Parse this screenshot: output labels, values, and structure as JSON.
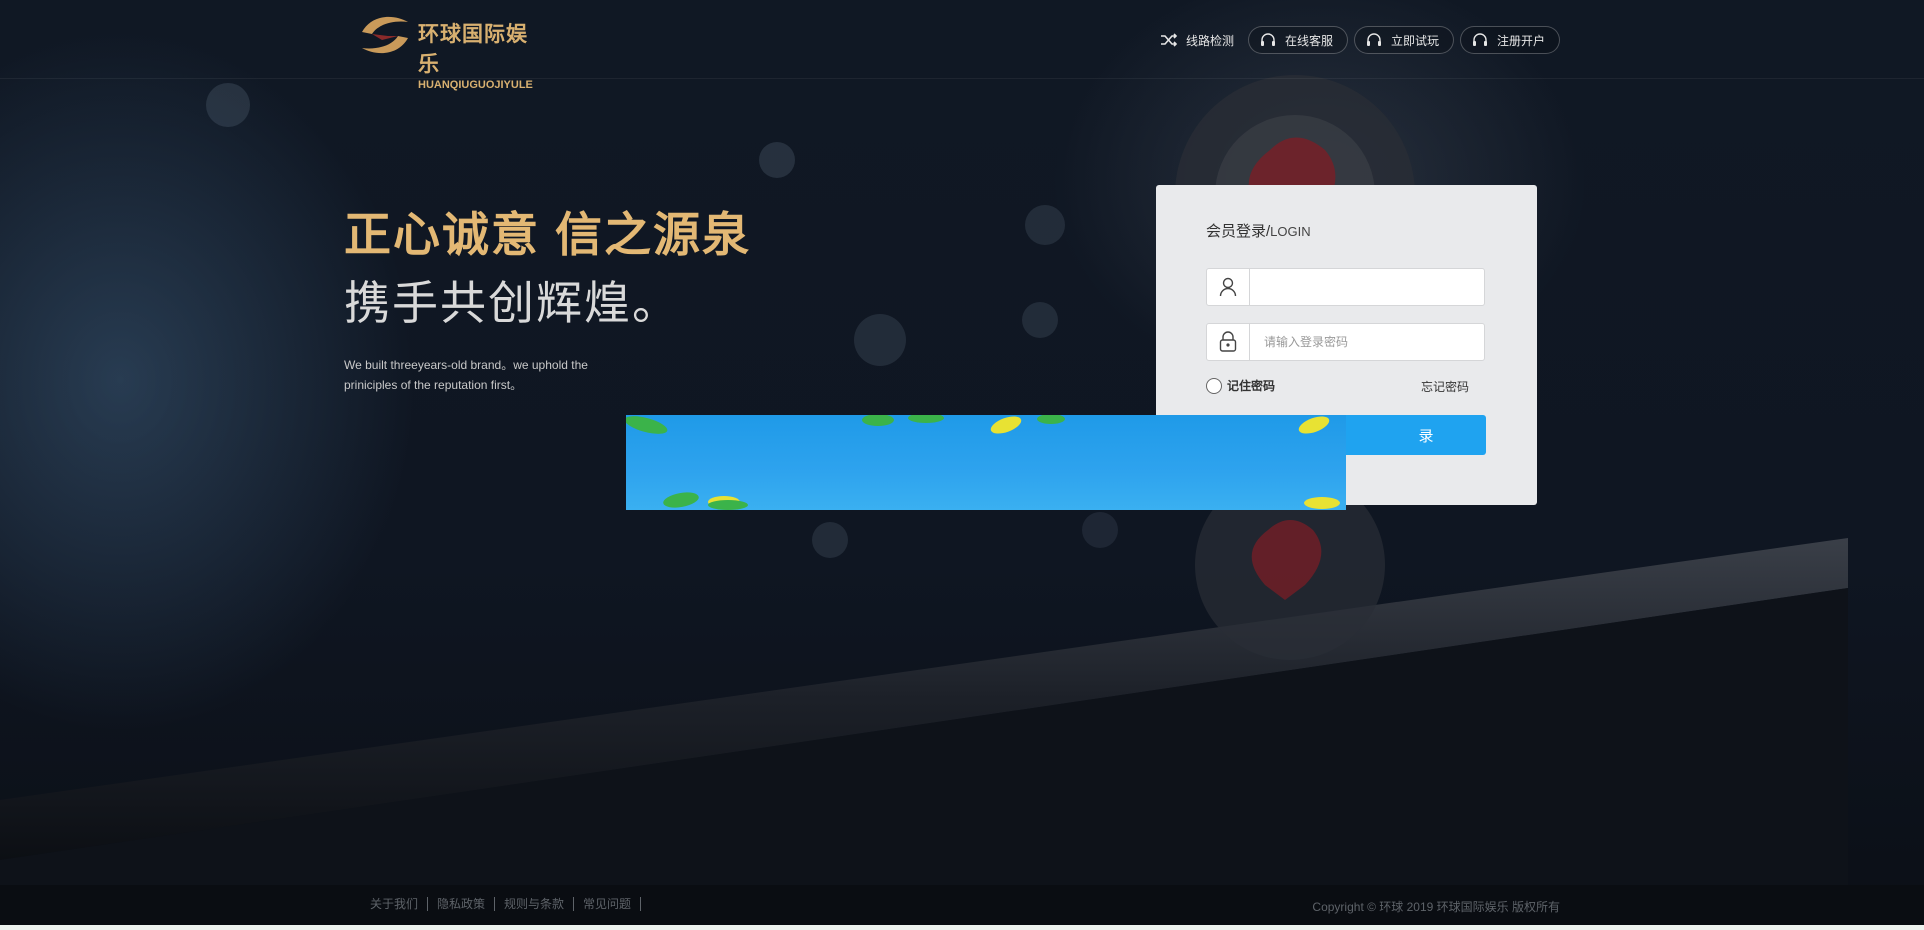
{
  "colors": {
    "accent_gold": "#e3b874",
    "login_button": "#1fa3f0",
    "panel_bg": "#e9eaec",
    "page_bg": "#0d1118"
  },
  "header": {
    "logo": {
      "cn": "环球国际娱乐",
      "en": "HUANQIUGUOJIYULE"
    },
    "nav": [
      {
        "label": "线路检测",
        "icon": "shuffle-icon"
      },
      {
        "label": "在线客服",
        "icon": "headset-icon"
      },
      {
        "label": "立即试玩",
        "icon": "headset-icon"
      },
      {
        "label": "注册开户",
        "icon": "headset-icon"
      }
    ]
  },
  "slogan": {
    "line1": "正心诚意 信之源泉",
    "line2": "携手共创辉煌。",
    "en_line1": "We built threeyears-old brand。we uphold the",
    "en_line2": "priniciples of the reputation first。"
  },
  "login": {
    "title": "会员登录/",
    "title_en": "LOGIN",
    "username": {
      "value": "",
      "placeholder": "",
      "icon": "user-icon"
    },
    "password": {
      "value": "",
      "placeholder": "请输入登录密码",
      "icon": "lock-icon"
    },
    "remember_label": "记住密码",
    "forgot_label": "忘记密码",
    "submit_label": "录"
  },
  "footer": {
    "links": [
      "关于我们",
      "隐私政策",
      "规则与条款",
      "常见问题"
    ],
    "copyright": "Copyright © 环球 2019 环球国际娱乐 版权所有"
  }
}
